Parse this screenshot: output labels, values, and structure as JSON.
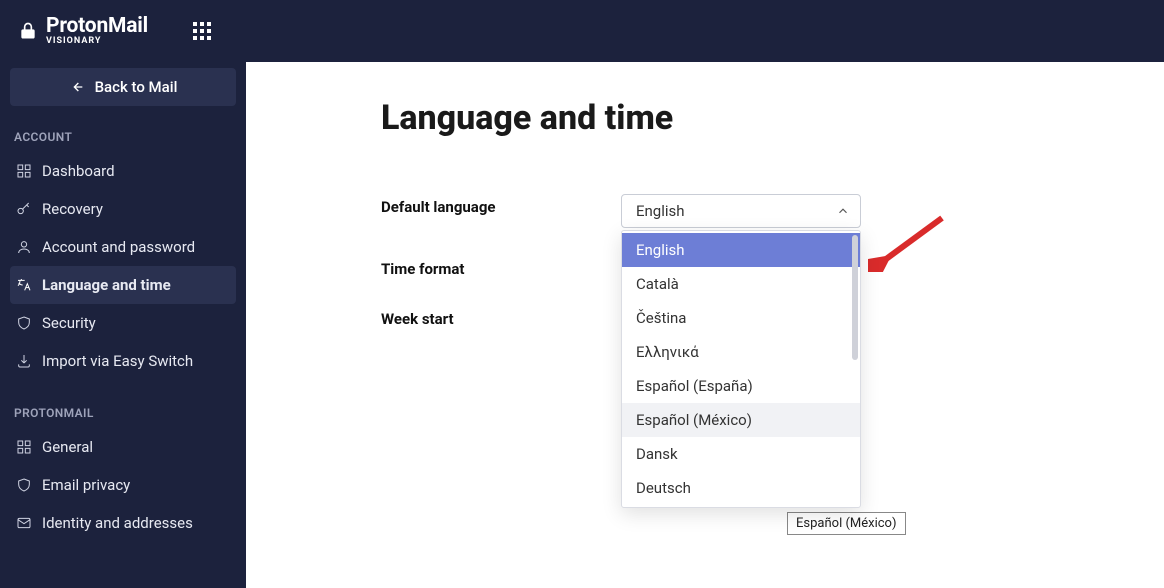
{
  "brand": {
    "name": "ProtonMail",
    "tier": "VISIONARY"
  },
  "back_button": "Back to Mail",
  "sidebar": {
    "groups": [
      {
        "title": "ACCOUNT",
        "items": [
          {
            "label": "Dashboard"
          },
          {
            "label": "Recovery"
          },
          {
            "label": "Account and password"
          },
          {
            "label": "Language and time",
            "active": true
          },
          {
            "label": "Security"
          },
          {
            "label": "Import via Easy Switch"
          }
        ]
      },
      {
        "title": "PROTONMAIL",
        "items": [
          {
            "label": "General"
          },
          {
            "label": "Email privacy"
          },
          {
            "label": "Identity and addresses"
          }
        ]
      }
    ]
  },
  "page": {
    "title": "Language and time",
    "settings": {
      "default_language": {
        "label": "Default language",
        "value": "English"
      },
      "time_format": {
        "label": "Time format"
      },
      "week_start": {
        "label": "Week start"
      }
    },
    "language_options": [
      "English",
      "Català",
      "Čeština",
      "Ελληνικά",
      "Español (España)",
      "Español (México)",
      "Dansk",
      "Deutsch"
    ],
    "language_selected_index": 0,
    "language_hover_index": 5,
    "tooltip_text": "Español (México)"
  },
  "colors": {
    "accent": "#6d7ed6",
    "sidebar_active": "#2a3150",
    "arrow": "#d92b2b"
  }
}
